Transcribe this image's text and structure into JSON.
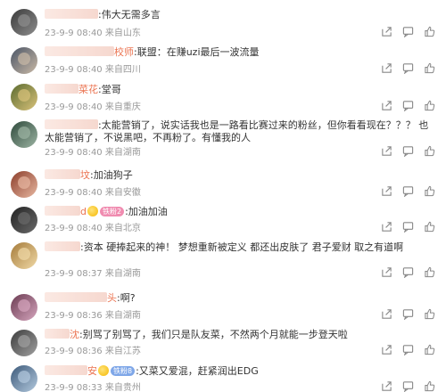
{
  "comments": [
    {
      "name": "",
      "text": ":伟大无需多言",
      "date": "23-9-9 08:40",
      "location": "来自山东",
      "badges": [],
      "avatar": [
        "#3a3a3a",
        "#8d8d8d"
      ]
    },
    {
      "name": "校师",
      "text": ":联盟：在赚uzi最后一波流量",
      "date": "23-9-9 08:40",
      "location": "来自四川",
      "badges": [],
      "avatar": [
        "#4b5566",
        "#c9b9a6"
      ]
    },
    {
      "name": "菜花",
      "text": ":堂哥",
      "date": "23-9-9 08:40",
      "location": "来自重庆",
      "badges": [],
      "avatar": [
        "#5b6b2f",
        "#d9c27a"
      ]
    },
    {
      "name": "",
      "text": ":太能营销了，说实话我也是一路看比赛过来的粉丝，但你看看现在？？？  也太能营销了，不说黑吧，不再粉了。有懂我的人",
      "date": "23-9-9 08:40",
      "location": "来自湖南",
      "badges": [],
      "avatar": [
        "#2f4a3c",
        "#9cb4a3"
      ]
    },
    {
      "name": "坟",
      "text": ":加油狗子",
      "date": "23-9-9 08:40",
      "location": "来自安徽",
      "badges": [],
      "avatar": [
        "#8c3e2a",
        "#e7b7a1"
      ]
    },
    {
      "name": "d",
      "text": ":加油加油",
      "date": "23-9-9 08:40",
      "location": "来自北京",
      "badges": [
        "铁粉2"
      ],
      "avatar": [
        "#222222",
        "#6a6a6a"
      ]
    },
    {
      "name": "",
      "text": ":资本 硬捧起来的神！ 梦想重新被定义  都还出皮肤了    君子爱财 取之有道啊",
      "date": "23-9-9 08:37",
      "location": "来自湖南",
      "badges": [],
      "avatar": [
        "#a57b3a",
        "#f0d9a6"
      ]
    },
    {
      "name": "头",
      "text": ":啊?",
      "date": "23-9-9 08:36",
      "location": "来自湖南",
      "badges": [],
      "avatar": [
        "#6b3b52",
        "#d5a5bd"
      ]
    },
    {
      "name": "沈",
      "text": ":别骂了别骂了，我们只是队友菜，不然两个月就能一步登天啦",
      "date": "23-9-9 08:36",
      "location": "来自江苏",
      "badges": [],
      "avatar": [
        "#3c3c3c",
        "#a0a0a0"
      ]
    },
    {
      "name": "安",
      "text": ":又菜又爱混，赶紧润出EDG",
      "date": "23-9-9 08:33",
      "location": "来自贵州",
      "badges": [
        "铁粉8"
      ],
      "avatar": [
        "#3c5a7a",
        "#b3c9de"
      ]
    }
  ]
}
